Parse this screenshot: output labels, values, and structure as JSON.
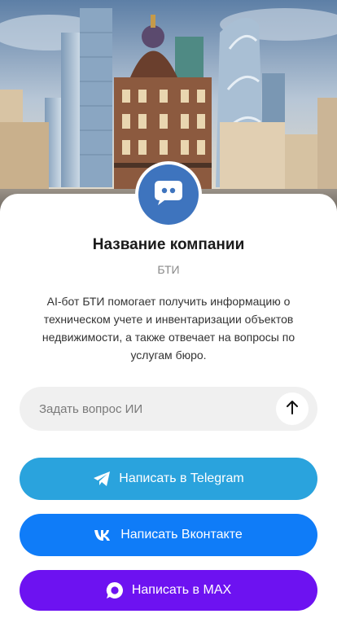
{
  "company": {
    "name": "Название компании",
    "subtitle": "БТИ",
    "description": "AI-бот БТИ помогает получить информацию о техническом учете и инвентаризации объектов недвижимости, а также отвечает на вопросы по услугам бюро."
  },
  "ask": {
    "placeholder": "Задать вопрос ИИ",
    "value": ""
  },
  "buttons": {
    "telegram": {
      "label": "Написать в Telegram",
      "icon": "telegram-icon",
      "color": "#2aa3dd"
    },
    "vk": {
      "label": "Написать Вконтакте",
      "icon": "vk-icon",
      "color": "#0f7cf8"
    },
    "max": {
      "label": "Написать в MAX",
      "icon": "max-icon",
      "color": "#6d12f1"
    }
  },
  "avatar": {
    "icon": "chat-bot-icon",
    "color": "#3e74be"
  }
}
